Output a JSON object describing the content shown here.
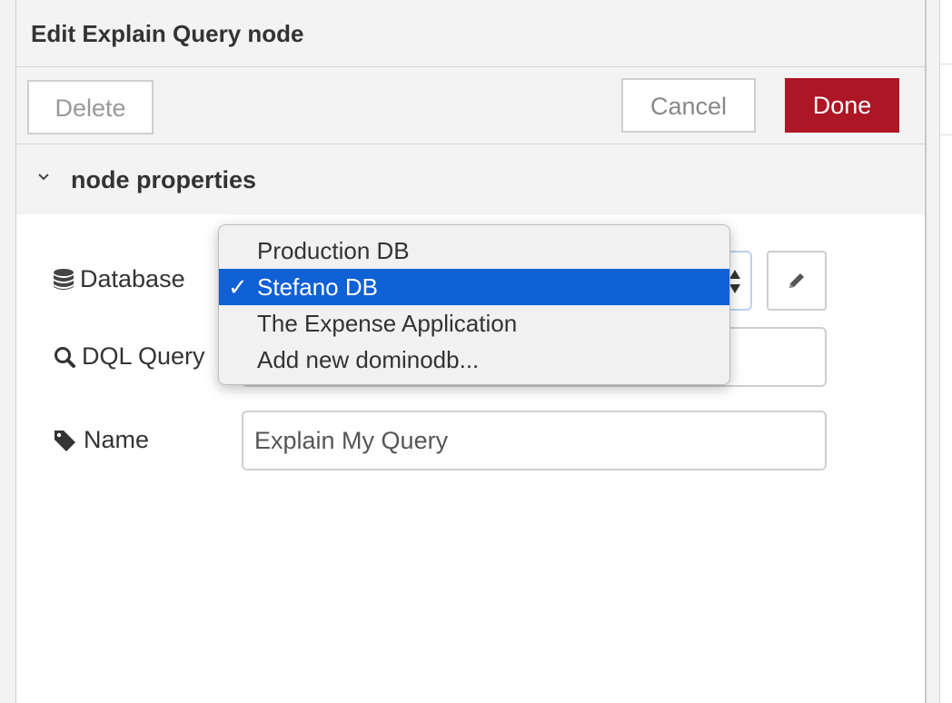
{
  "header": {
    "title": "Edit Explain Query node"
  },
  "toolbar": {
    "delete_label": "Delete",
    "cancel_label": "Cancel",
    "done_label": "Done"
  },
  "section": {
    "title": "node properties"
  },
  "form": {
    "database_label": "Database",
    "dql_label": "DQL Query",
    "name_label": "Name",
    "name_value": "Explain My Query"
  },
  "dropdown": {
    "options": [
      {
        "label": "Production DB",
        "selected": false
      },
      {
        "label": "Stefano DB",
        "selected": true
      },
      {
        "label": "The Expense Application",
        "selected": false
      },
      {
        "label": "Add new dominodb...",
        "selected": false
      }
    ],
    "check_mark": "✓"
  },
  "icons": {
    "database": "database-icon",
    "search": "search-icon",
    "tag": "tag-icon",
    "pencil": "pencil-icon",
    "chevron": "chevron-down-icon"
  },
  "colors": {
    "done": "#ad1625",
    "selection": "#1060d6"
  }
}
